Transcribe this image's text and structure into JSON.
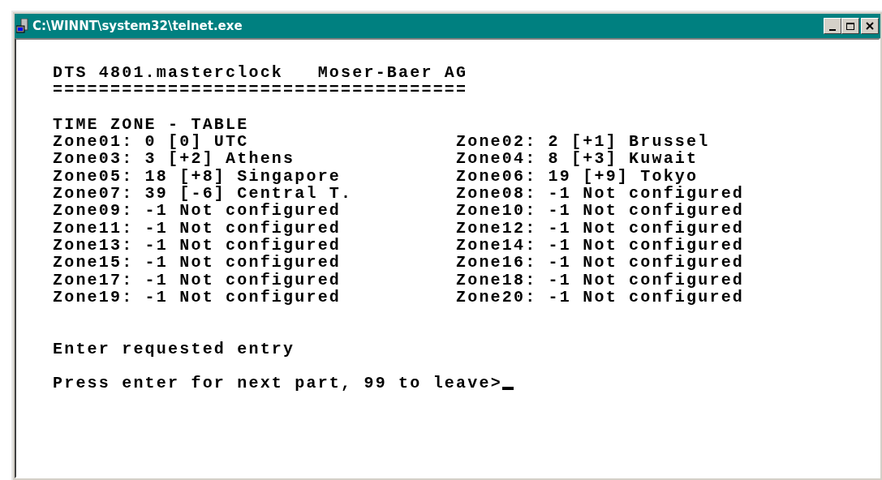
{
  "window": {
    "title": "C:\\WINNT\\system32\\telnet.exe"
  },
  "terminal": {
    "header": "DTS 4801.masterclock   Moser-Baer AG",
    "rule": "====================================",
    "heading": "TIME ZONE - TABLE",
    "zones": [
      {
        "left": "Zone01: 0 [0] UTC",
        "right": "Zone02: 2 [+1] Brussel"
      },
      {
        "left": "Zone03: 3 [+2] Athens",
        "right": "Zone04: 8 [+3] Kuwait"
      },
      {
        "left": "Zone05: 18 [+8] Singapore",
        "right": "Zone06: 19 [+9] Tokyo"
      },
      {
        "left": "Zone07: 39 [-6] Central T.",
        "right": "Zone08: -1 Not configured"
      },
      {
        "left": "Zone09: -1 Not configured",
        "right": "Zone10: -1 Not configured"
      },
      {
        "left": "Zone11: -1 Not configured",
        "right": "Zone12: -1 Not configured"
      },
      {
        "left": "Zone13: -1 Not configured",
        "right": "Zone14: -1 Not configured"
      },
      {
        "left": "Zone15: -1 Not configured",
        "right": "Zone16: -1 Not configured"
      },
      {
        "left": "Zone17: -1 Not configured",
        "right": "Zone18: -1 Not configured"
      },
      {
        "left": "Zone19: -1 Not configured",
        "right": "Zone20: -1 Not configured"
      }
    ],
    "message": "Enter requested entry",
    "prompt": "Press enter for next part, 99 to leave>"
  }
}
